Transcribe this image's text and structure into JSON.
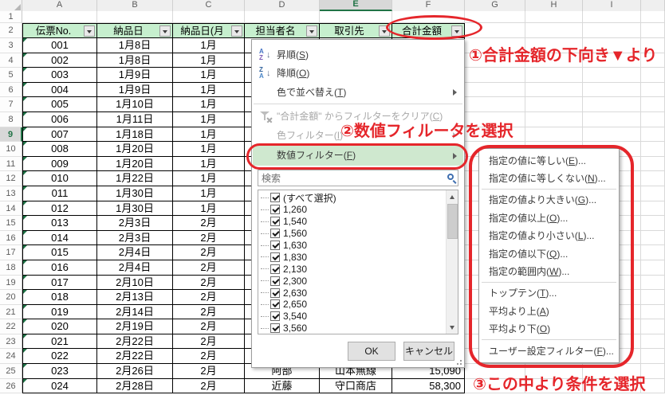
{
  "sheet": {
    "row1": "1",
    "row2": "2",
    "selected_column": "E",
    "selected_row": "9"
  },
  "columns": {
    "letters": [
      "A",
      "B",
      "C",
      "D",
      "E",
      "F",
      "G",
      "H",
      "I"
    ]
  },
  "table": {
    "headers": [
      {
        "label": "伝票No."
      },
      {
        "label": "納品日"
      },
      {
        "label": "納品日(月"
      },
      {
        "label": "担当者名"
      },
      {
        "label": "取引先"
      },
      {
        "label": "合計金額"
      }
    ],
    "rows": [
      {
        "n": "3",
        "a": "001",
        "b": "1月8日",
        "c": "1月",
        "d": "",
        "e": "",
        "f": ""
      },
      {
        "n": "4",
        "a": "002",
        "b": "1月8日",
        "c": "1月",
        "d": "",
        "e": "",
        "f": ""
      },
      {
        "n": "5",
        "a": "003",
        "b": "1月9日",
        "c": "1月",
        "d": "",
        "e": "",
        "f": ""
      },
      {
        "n": "6",
        "a": "004",
        "b": "1月9日",
        "c": "1月",
        "d": "",
        "e": "",
        "f": ""
      },
      {
        "n": "7",
        "a": "005",
        "b": "1月10日",
        "c": "1月",
        "d": "",
        "e": "",
        "f": ""
      },
      {
        "n": "8",
        "a": "006",
        "b": "1月11日",
        "c": "1月",
        "d": "",
        "e": "",
        "f": ""
      },
      {
        "n": "9",
        "a": "007",
        "b": "1月18日",
        "c": "1月",
        "d": "",
        "e": "",
        "f": ""
      },
      {
        "n": "10",
        "a": "008",
        "b": "1月20日",
        "c": "1月",
        "d": "",
        "e": "",
        "f": ""
      },
      {
        "n": "11",
        "a": "009",
        "b": "1月20日",
        "c": "1月",
        "d": "",
        "e": "",
        "f": ""
      },
      {
        "n": "12",
        "a": "010",
        "b": "1月22日",
        "c": "1月",
        "d": "",
        "e": "",
        "f": ""
      },
      {
        "n": "13",
        "a": "011",
        "b": "1月30日",
        "c": "1月",
        "d": "",
        "e": "",
        "f": ""
      },
      {
        "n": "14",
        "a": "012",
        "b": "1月30日",
        "c": "1月",
        "d": "",
        "e": "",
        "f": ""
      },
      {
        "n": "15",
        "a": "013",
        "b": "2月3日",
        "c": "2月",
        "d": "",
        "e": "",
        "f": ""
      },
      {
        "n": "16",
        "a": "014",
        "b": "2月3日",
        "c": "2月",
        "d": "",
        "e": "",
        "f": ""
      },
      {
        "n": "17",
        "a": "015",
        "b": "2月4日",
        "c": "2月",
        "d": "",
        "e": "",
        "f": ""
      },
      {
        "n": "18",
        "a": "016",
        "b": "2月4日",
        "c": "2月",
        "d": "",
        "e": "",
        "f": ""
      },
      {
        "n": "19",
        "a": "017",
        "b": "2月10日",
        "c": "2月",
        "d": "",
        "e": "",
        "f": ""
      },
      {
        "n": "20",
        "a": "018",
        "b": "2月13日",
        "c": "2月",
        "d": "",
        "e": "",
        "f": ""
      },
      {
        "n": "21",
        "a": "019",
        "b": "2月14日",
        "c": "2月",
        "d": "",
        "e": "",
        "f": ""
      },
      {
        "n": "22",
        "a": "020",
        "b": "2月19日",
        "c": "2月",
        "d": "",
        "e": "",
        "f": ""
      },
      {
        "n": "23",
        "a": "021",
        "b": "2月22日",
        "c": "2月",
        "d": "",
        "e": "",
        "f": ""
      },
      {
        "n": "24",
        "a": "022",
        "b": "2月22日",
        "c": "2月",
        "d": "",
        "e": "",
        "f": ""
      },
      {
        "n": "25",
        "a": "023",
        "b": "2月26日",
        "c": "2月",
        "d": "阿部",
        "e": "山本無線",
        "f": "15,090"
      },
      {
        "n": "26",
        "a": "024",
        "b": "2月28日",
        "c": "2月",
        "d": "近藤",
        "e": "守口商店",
        "f": "58,300"
      }
    ]
  },
  "filter_menu": {
    "sort_asc": "昇順(S)",
    "sort_desc": "降順(O)",
    "sort_by_color": "色で並べ替え(T)",
    "clear_filter": "\"合計金額\" からフィルターをクリア(C)",
    "color_filter": "色フィルター(I)",
    "number_filter": "数値フィルター(F)",
    "search_placeholder": "検索",
    "values": [
      "(すべて選択)",
      "1,260",
      "1,540",
      "1,560",
      "1,630",
      "1,830",
      "2,130",
      "2,300",
      "2,630",
      "2,650",
      "3,540",
      "3,560"
    ],
    "ok": "OK",
    "cancel": "キャンセル"
  },
  "submenu": {
    "group1": [
      {
        "label": "指定の値に等しい(E)..."
      },
      {
        "label": "指定の値に等しくない(N)..."
      }
    ],
    "group2": [
      {
        "label": "指定の値より大きい(G)..."
      },
      {
        "label": "指定の値以上(O)..."
      },
      {
        "label": "指定の値より小さい(L)..."
      },
      {
        "label": "指定の値以下(Q)..."
      },
      {
        "label": "指定の範囲内(W)..."
      }
    ],
    "group3": [
      {
        "label": "トップテン(T)..."
      },
      {
        "label": "平均より上(A)"
      },
      {
        "label": "平均より下(O)"
      }
    ],
    "group4": [
      {
        "label": "ユーザー設定フィルター(F)..."
      }
    ]
  },
  "annotations": {
    "step1": "①合計金額の下向き▼より",
    "step2": "②数値フィルータを選択",
    "step3": "③この中より条件を選択"
  },
  "colors": {
    "header_fill": "#c6efce",
    "accent_green": "#217346",
    "annotation_red": "#e5262b",
    "menu_highlight": "#cfe8cf"
  }
}
